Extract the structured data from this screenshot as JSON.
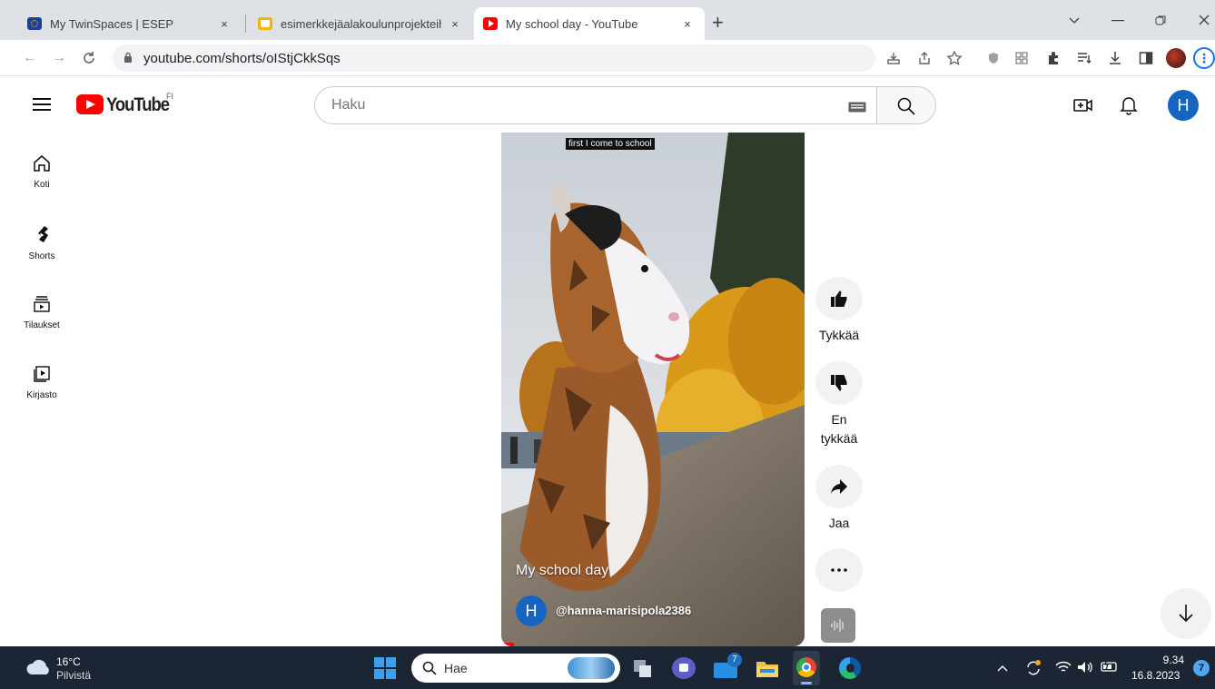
{
  "browser": {
    "tabs": [
      {
        "title": "My TwinSpaces | ESEP",
        "active": false
      },
      {
        "title": "esimerkkejäalakoulunprojekteihin",
        "active": false
      },
      {
        "title": "My school day - YouTube",
        "active": true
      }
    ],
    "url": "youtube.com/shorts/oIStjCkkSqs",
    "tab_close_glyph": "×",
    "new_tab_glyph": "+"
  },
  "youtube": {
    "country_code": "FI",
    "search_placeholder": "Haku",
    "avatar_letter": "H",
    "sidebar": [
      {
        "label": "Koti",
        "icon": "home-icon"
      },
      {
        "label": "Shorts",
        "icon": "shorts-icon"
      },
      {
        "label": "Tilaukset",
        "icon": "subscriptions-icon"
      },
      {
        "label": "Kirjasto",
        "icon": "library-icon"
      }
    ],
    "video": {
      "caption": "first I come to school",
      "title": "My school day",
      "channel": "@hanna-marisipola2386",
      "channel_letter": "H"
    },
    "actions": {
      "like": "Tykkää",
      "dislike_line1": "En",
      "dislike_line2": "tykkää",
      "share": "Jaa"
    }
  },
  "taskbar": {
    "temperature": "16°C",
    "weather": "Pilvistä",
    "search": "Hae",
    "mail_badge": "7",
    "time": "9.34",
    "date": "16.8.2023",
    "notification_count": "7"
  },
  "colors": {
    "youtube_red": "#ff0000",
    "accent_blue": "#1565c0",
    "taskbar": "#1c2533"
  }
}
